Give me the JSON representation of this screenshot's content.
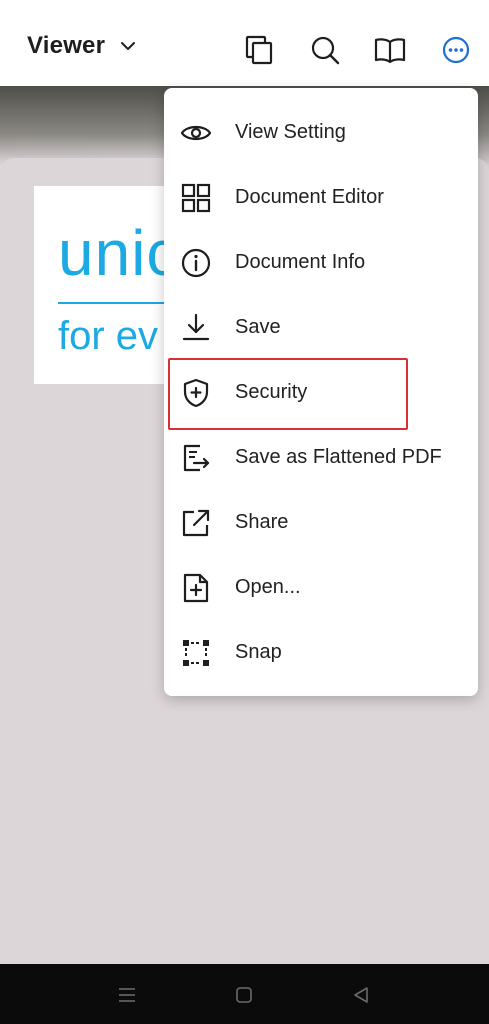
{
  "appbar": {
    "title": "Viewer",
    "icons": [
      "chevron-down-icon",
      "pages-icon",
      "search-icon",
      "book-icon",
      "more-icon"
    ],
    "accent_color": "#1f6fd1"
  },
  "document": {
    "logo_text": "unic",
    "logo_subtext": "for ev",
    "logo_color": "#1ca9e4"
  },
  "menu": {
    "items": [
      {
        "label": "View Setting",
        "icon": "eye-icon"
      },
      {
        "label": "Document Editor",
        "icon": "grid-icon"
      },
      {
        "label": "Document Info",
        "icon": "info-icon"
      },
      {
        "label": "Save",
        "icon": "download-icon"
      },
      {
        "label": "Security",
        "icon": "shield-plus-icon"
      },
      {
        "label": "Save as Flattened PDF",
        "icon": "flatten-icon"
      },
      {
        "label": "Share",
        "icon": "share-icon"
      },
      {
        "label": "Open...",
        "icon": "file-plus-icon"
      },
      {
        "label": "Snap",
        "icon": "snap-icon"
      }
    ],
    "highlighted_item": "Security",
    "highlight_color": "#d93036"
  },
  "navbar": {
    "icons": [
      "menu-icon",
      "home-icon",
      "back-icon"
    ]
  }
}
